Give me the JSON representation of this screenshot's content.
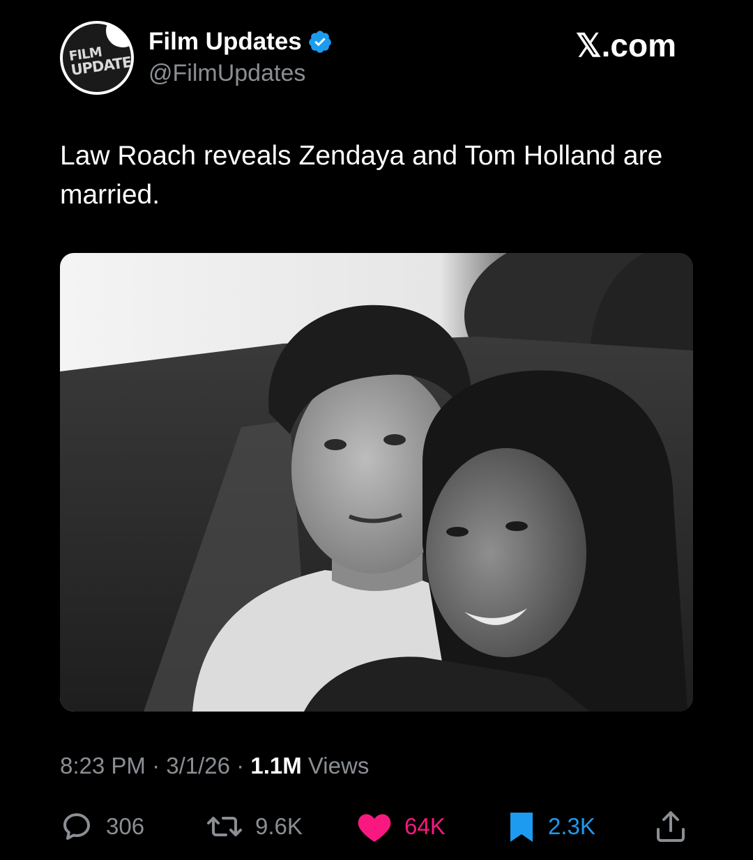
{
  "account": {
    "avatar_text_line1": "FILM",
    "avatar_text_line2": "UPDATES",
    "display_name": "Film Updates",
    "handle": "@FilmUpdates",
    "verified": true
  },
  "brand": {
    "label": "𝕏.com"
  },
  "tweet": {
    "text": "Law Roach reveals Zendaya and Tom Holland are married.",
    "media_icon": "photo-black-and-white-couple",
    "time": "8:23 PM",
    "date": "3/1/26",
    "separator": "·",
    "views_count": "1.1M",
    "views_label": "Views"
  },
  "actions": {
    "replies": "306",
    "retweets": "9.6K",
    "likes": "64K",
    "bookmarks": "2.3K"
  },
  "colors": {
    "background": "#000000",
    "text_primary": "#ffffff",
    "text_secondary": "#8b8f94",
    "like": "#f91880",
    "bookmark": "#1d9bf0",
    "verified": "#1d9bf0"
  }
}
